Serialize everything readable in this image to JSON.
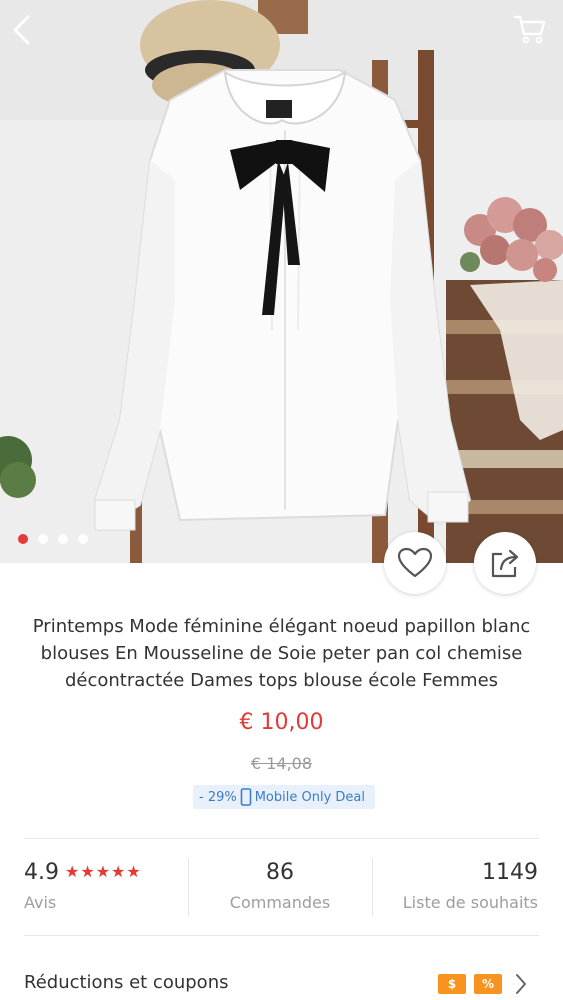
{
  "gallery": {
    "slide_count": 4,
    "active_slide": 1
  },
  "product": {
    "title": "Printemps Mode féminine élégant noeud papillon blanc blouses En Mousseline de Soie peter pan col chemise décontractée Dames tops blouse école Femmes",
    "price": "€ 10,00",
    "old_price": "€ 14,08",
    "deal_discount": "- 29%",
    "deal_label": "Mobile Only Deal"
  },
  "stats": {
    "rating_value": "4.9",
    "rating_label": "Avis",
    "stars": "★★★★★",
    "orders_value": "86",
    "orders_label": "Commandes",
    "wishlist_value": "1149",
    "wishlist_label": "Liste de souhaits"
  },
  "coupons": {
    "label": "Réductions et coupons",
    "badge_1": "$",
    "badge_2": "%"
  },
  "icons": [
    "back-arrow-icon",
    "cart-icon",
    "heart-icon",
    "share-icon",
    "chevron-right-icon",
    "mobile-phone-icon"
  ],
  "colors": {
    "price": "#e53935",
    "deal_bg": "#e8f1fb",
    "deal_text": "#3d7cc9",
    "badge": "#f7931e",
    "active_dot": "#e53935"
  }
}
